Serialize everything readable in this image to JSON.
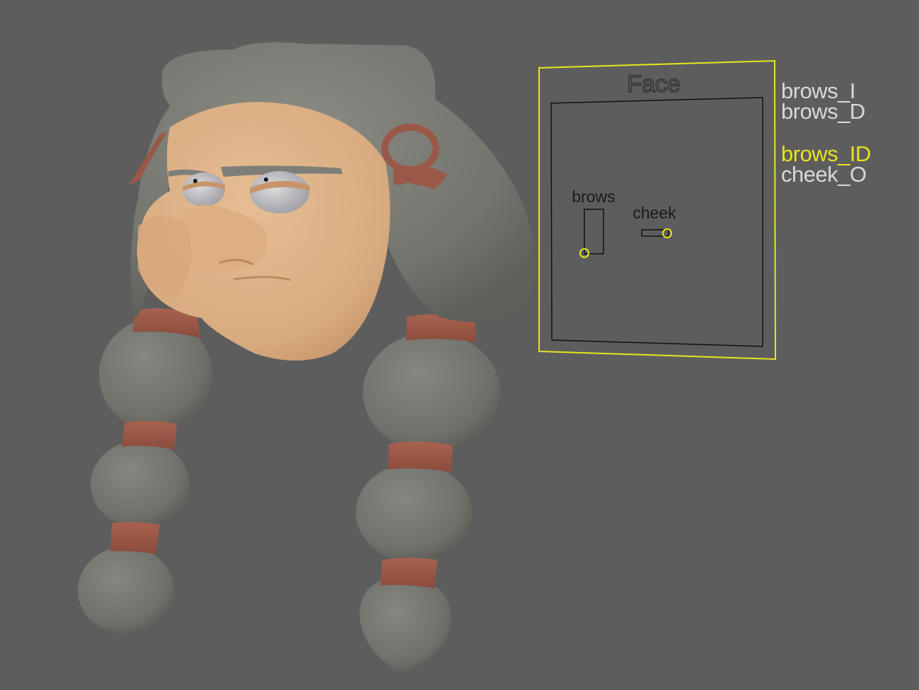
{
  "viewport": {
    "background": "#5d5d5d",
    "selection_color": "#e6e61e",
    "model_colors": {
      "skin": "#dfb58b",
      "hair": "#7b7c74",
      "bands": "#9a5848",
      "brows": "#7d7e78"
    }
  },
  "face_controller": {
    "title": "Face",
    "controls": [
      {
        "label": "brows"
      },
      {
        "label": "cheek"
      }
    ]
  },
  "channel_list": {
    "attributes": [
      {
        "name": "brows_I",
        "selected": false
      },
      {
        "name": "brows_D",
        "selected": false
      },
      {
        "name": "brows_ID",
        "selected": true
      },
      {
        "name": "cheek_O",
        "selected": false
      }
    ],
    "colors": {
      "normal": "#d8d8d8",
      "selected": "#e8e21a"
    }
  }
}
